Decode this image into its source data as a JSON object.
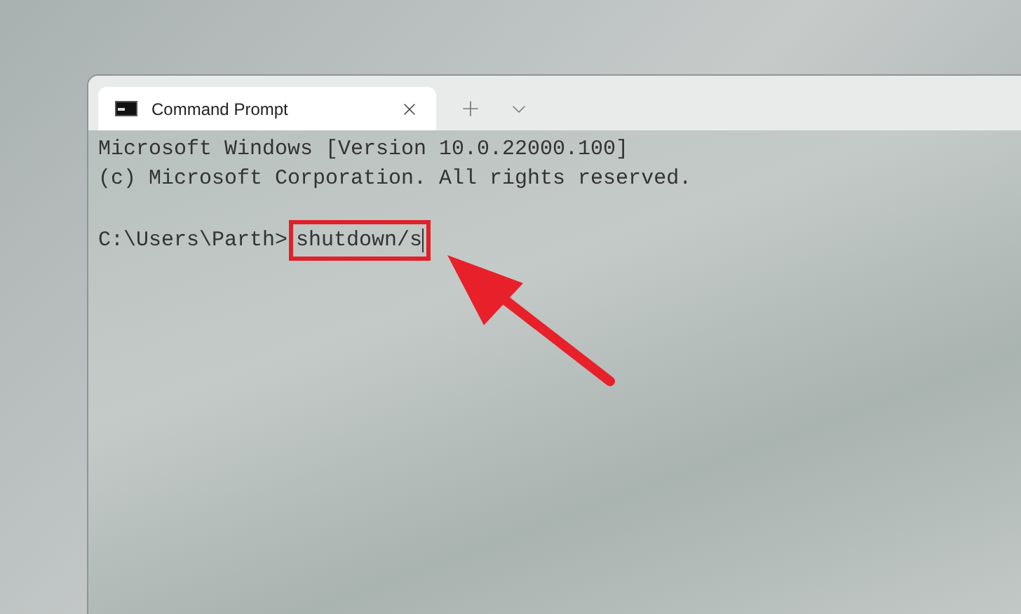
{
  "window": {
    "tabs": [
      {
        "title": "Command Prompt",
        "selected": true
      }
    ]
  },
  "terminal": {
    "lines": [
      "Microsoft Windows [Version 10.0.22000.100]",
      "(c) Microsoft Corporation. All rights reserved."
    ],
    "prompt": "C:\\Users\\Parth>",
    "command": "shutdown/s"
  }
}
